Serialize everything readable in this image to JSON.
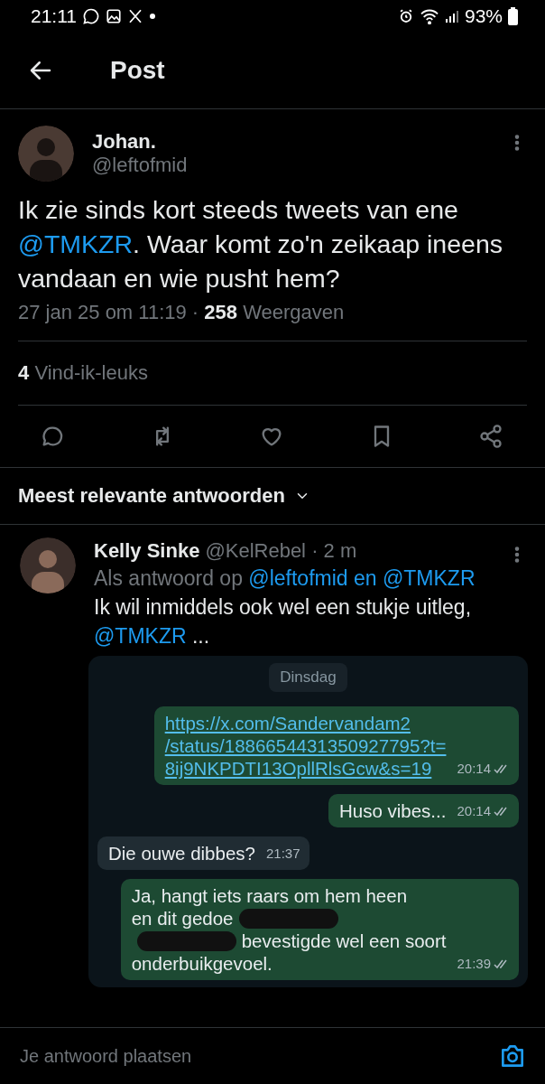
{
  "status_bar": {
    "time": "21:11",
    "battery": "93%"
  },
  "header": {
    "title": "Post"
  },
  "post": {
    "author": "Johan.",
    "handle": "@leftofmid",
    "text": [
      {
        "kind": "plain",
        "text": "Ik zie sinds kort steeds tweets van ene "
      },
      {
        "kind": "mention",
        "text": "@TMKZR"
      },
      {
        "kind": "plain",
        "text": ". Waar komt zo'n zeikaap ineens vandaan en wie pusht hem?"
      }
    ],
    "date": "27 jan 25 om 11:19",
    "separator": "·",
    "views_count": "258",
    "views_label": "Weergaven",
    "likes_count": "4",
    "likes_label": "Vind-ik-leuks"
  },
  "replies_sort": {
    "label": "Meest relevante antwoorden"
  },
  "reply": {
    "author": "Kelly Sinke",
    "handle": "@KelRebel",
    "separator": "·",
    "time": "2 m",
    "reply_to": [
      {
        "kind": "plain",
        "text": "Als antwoord op "
      },
      {
        "kind": "mention",
        "text": "@leftofmid en @TMKZR"
      }
    ],
    "text": [
      {
        "kind": "plain",
        "text": "Ik wil inmiddels ook wel een stukje uitleg, "
      },
      {
        "kind": "mention",
        "text": "@TMKZR"
      },
      {
        "kind": "plain",
        "text": " ..."
      }
    ],
    "chat": {
      "date_chip": "Dinsdag",
      "messages": [
        {
          "kind": "outgoing",
          "link": true,
          "lines": [
            [
              {
                "kind": "text",
                "text": "https://x.com/Sandervandam2"
              }
            ],
            [
              {
                "kind": "text",
                "text": "/status/1886654431350927795?t="
              }
            ],
            [
              {
                "kind": "text",
                "text": "8ij9NKPDTI13OpllRlsGcw&s=19"
              }
            ]
          ],
          "time": "20:14"
        },
        {
          "kind": "outgoing",
          "link": false,
          "lines": [
            [
              {
                "kind": "text",
                "text": "Huso vibes..."
              }
            ]
          ],
          "time": "20:14"
        },
        {
          "kind": "incoming",
          "link": false,
          "lines": [
            [
              {
                "kind": "text",
                "text": "Die ouwe dibbes?"
              }
            ]
          ],
          "time": "21:37"
        },
        {
          "kind": "outgoing",
          "link": false,
          "lines": [
            [
              {
                "kind": "text",
                "text": "Ja, hangt iets raars om hem heen"
              }
            ],
            [
              {
                "kind": "text",
                "text": "en dit gedoe"
              },
              {
                "kind": "redacted"
              }
            ],
            [
              {
                "kind": "redacted"
              },
              {
                "kind": "text",
                "text": "bevestigde wel een soort"
              }
            ],
            [
              {
                "kind": "text",
                "text": "onderbuikgevoel."
              }
            ]
          ],
          "time": "21:39"
        }
      ]
    }
  },
  "composer": {
    "placeholder": "Je antwoord plaatsen"
  }
}
